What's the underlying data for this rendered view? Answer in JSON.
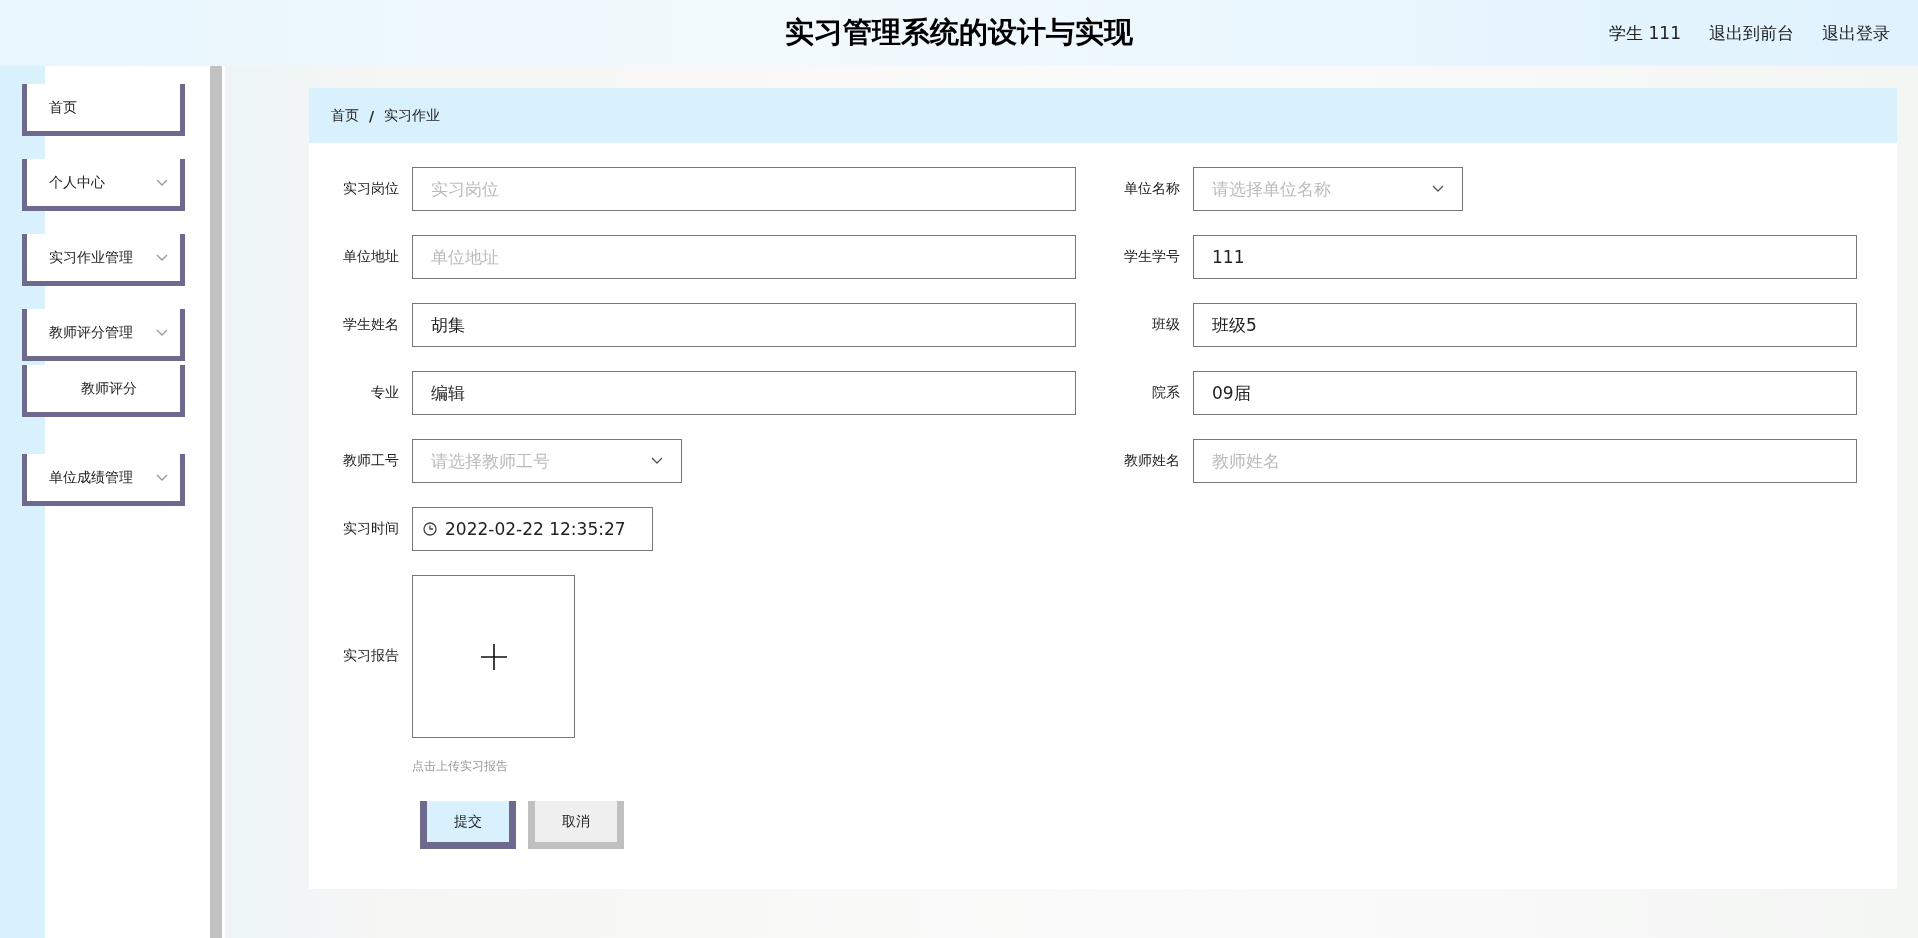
{
  "header": {
    "title": "实习管理系统的设计与实现",
    "links": [
      {
        "label": "学生 111"
      },
      {
        "label": "退出到前台"
      },
      {
        "label": "退出登录"
      }
    ]
  },
  "sidebar": {
    "items": [
      {
        "label": "首页",
        "kind": "link"
      },
      {
        "label": "个人中心",
        "kind": "submenu"
      },
      {
        "label": "实习作业管理",
        "kind": "submenu"
      },
      {
        "label": "教师评分管理",
        "kind": "submenu",
        "children": [
          {
            "label": "教师评分"
          }
        ]
      },
      {
        "label": "单位成绩管理",
        "kind": "submenu"
      }
    ]
  },
  "breadcrumb": {
    "separator": "/",
    "items": [
      "首页",
      "实习作业"
    ]
  },
  "form": {
    "rows": [
      [
        {
          "label": "实习岗位",
          "kind": "text",
          "placeholder": "实习岗位"
        },
        {
          "label": "单位名称",
          "kind": "select",
          "placeholder": "请选择单位名称"
        }
      ],
      [
        {
          "label": "单位地址",
          "kind": "text",
          "placeholder": "单位地址"
        },
        {
          "label": "学生学号",
          "kind": "text",
          "value": "111"
        }
      ],
      [
        {
          "label": "学生姓名",
          "kind": "text",
          "value": "胡集"
        },
        {
          "label": "班级",
          "kind": "text",
          "value": "班级5"
        }
      ],
      [
        {
          "label": "专业",
          "kind": "text",
          "value": "编辑"
        },
        {
          "label": "院系",
          "kind": "text",
          "value": "09届"
        }
      ],
      [
        {
          "label": "教师工号",
          "kind": "select",
          "placeholder": "请选择教师工号"
        },
        {
          "label": "教师姓名",
          "kind": "text",
          "placeholder": "教师姓名"
        }
      ],
      [
        {
          "label": "实习时间",
          "kind": "datetime",
          "value": "2022-02-22 12:35:27"
        }
      ],
      [
        {
          "label": "实习报告",
          "kind": "upload",
          "hint": "点击上传实习报告"
        }
      ]
    ],
    "buttons": [
      {
        "label": "提交",
        "kind": "primary"
      },
      {
        "label": "取消",
        "kind": "secondary"
      }
    ]
  }
}
